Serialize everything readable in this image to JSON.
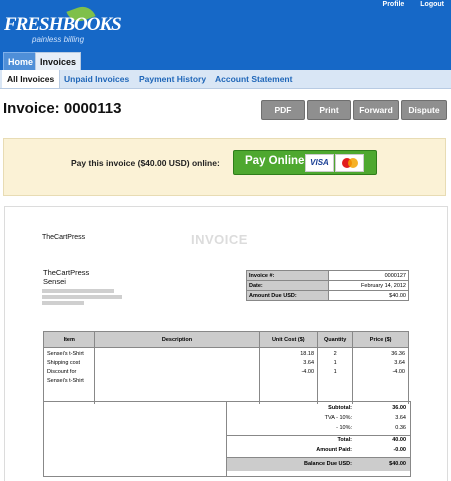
{
  "brand": {
    "logo_text": "FRESHBOOKS",
    "tagline": "painless billing",
    "accent": "#1668c7",
    "leaf": "#7fc04a"
  },
  "toplinks": {
    "profile": "Profile",
    "logout": "Logout"
  },
  "tabs": {
    "home": "Home",
    "invoices": "Invoices"
  },
  "subnav": {
    "all_invoices": "All Invoices",
    "unpaid": "Unpaid Invoices",
    "payment_history": "Payment History",
    "account_statement": "Account Statement"
  },
  "page": {
    "title": "Invoice: 0000113"
  },
  "actions": {
    "pdf": "PDF",
    "print": "Print",
    "forward": "Forward",
    "dispute": "Dispute"
  },
  "payment": {
    "prompt": "Pay this invoice ($40.00 USD) online:",
    "button": "Pay Online",
    "visa": "VISA"
  },
  "invoice": {
    "from_name": "TheCartPress",
    "heading": "INVOICE",
    "client_company": "TheCartPress",
    "client_name": "Sensei",
    "meta": [
      {
        "label": "Invoice #:",
        "value": "0000127"
      },
      {
        "label": "Date:",
        "value": "February 14, 2012"
      },
      {
        "label": "Amount Due USD:",
        "value": "$40.00"
      }
    ],
    "columns": {
      "item": "Item",
      "description": "Description",
      "unit_cost": "Unit Cost ($)",
      "quantity": "Quantity",
      "price": "Price ($)"
    },
    "rows": [
      {
        "item": "Sensei's t-Shirt",
        "description": "",
        "unit_cost": "18.18",
        "quantity": "2",
        "price": "36.36"
      },
      {
        "item": "Shipping cost",
        "description": "",
        "unit_cost": "3.64",
        "quantity": "1",
        "price": "3.64"
      },
      {
        "item": "Discount for Sensei's t-Shirt",
        "description": "",
        "unit_cost": "-4.00",
        "quantity": "1",
        "price": "-4.00"
      }
    ],
    "totals": {
      "subtotal_label": "Subtotal:",
      "subtotal": "36.00",
      "tax1_label": "TVA - 10%:",
      "tax1": "3.64",
      "tax2_label": "- 10%:",
      "tax2": "0.36",
      "total_label": "Total:",
      "total": "40.00",
      "paid_label": "Amount Paid:",
      "paid": "-0.00",
      "balance_label": "Balance Due USD:",
      "balance": "$40.00"
    }
  }
}
